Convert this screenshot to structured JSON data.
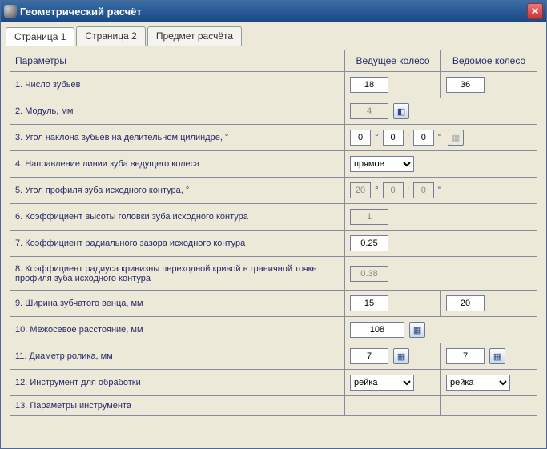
{
  "window": {
    "title": "Геометрический расчёт"
  },
  "tabs": {
    "page1": "Страница 1",
    "page2": "Страница 2",
    "subject": "Предмет расчёта"
  },
  "headers": {
    "params": "Параметры",
    "driving": "Ведущее колесо",
    "driven": "Ведомое колесо"
  },
  "rows": {
    "r1": {
      "label": "1. Число зубьев",
      "driving": "18",
      "driven": "36"
    },
    "r2": {
      "label": "2. Модуль, мм",
      "value": "4"
    },
    "r3": {
      "label": "3. Угол наклона зубьев на делительном цилиндре, °",
      "deg": "0",
      "min": "0",
      "sec": "0"
    },
    "r4": {
      "label": "4. Направление линии зуба ведущего колеса",
      "value": "прямое"
    },
    "r5": {
      "label": "5. Угол профиля зуба исходного контура, °",
      "deg": "20",
      "min": "0",
      "sec": "0"
    },
    "r6": {
      "label": "6. Коэффициент высоты головки зуба исходного контура",
      "value": "1"
    },
    "r7": {
      "label": "7. Коэффициент радиального зазора исходного контура",
      "value": "0.25"
    },
    "r8": {
      "label": "8. Коэффициент радиуса кривизны переходной кривой в граничной точке профиля зуба исходного контура",
      "value": "0.38"
    },
    "r9": {
      "label": "9. Ширина зубчатого венца, мм",
      "driving": "15",
      "driven": "20"
    },
    "r10": {
      "label": "10. Межосевое расстояние, мм",
      "value": "108"
    },
    "r11": {
      "label": "11. Диаметр ролика, мм",
      "driving": "7",
      "driven": "7"
    },
    "r12": {
      "label": "12. Инструмент для обработки",
      "driving": "рейка",
      "driven": "рейка"
    },
    "r13": {
      "label": "13. Параметры инструмента"
    }
  },
  "dms": {
    "deg": "°",
    "min": "'",
    "sec": "''"
  }
}
